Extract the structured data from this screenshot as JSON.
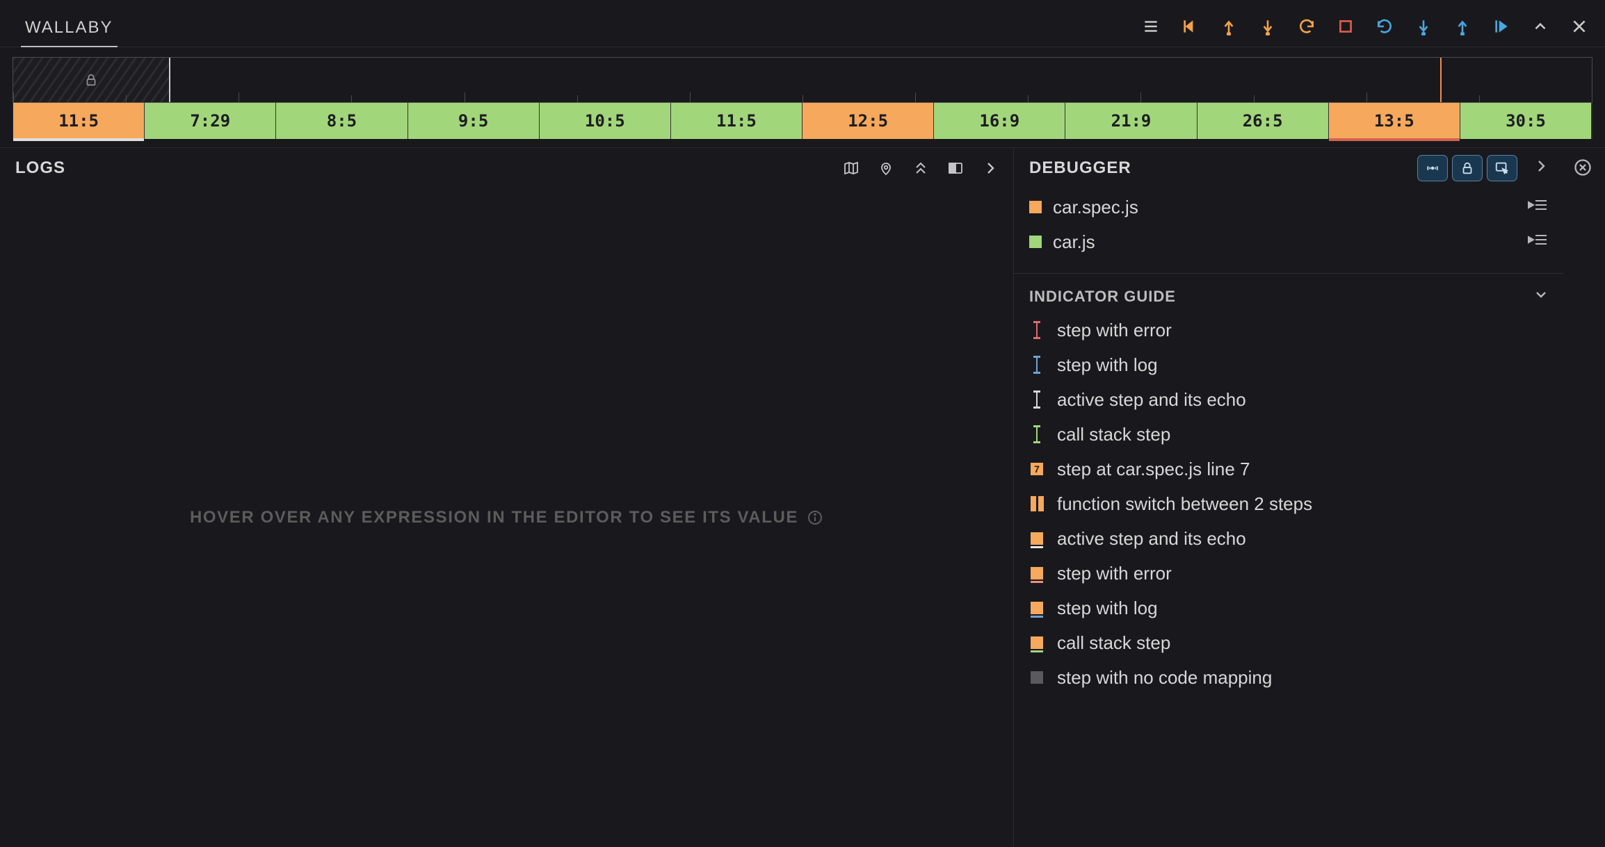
{
  "header": {
    "tab": "WALLABY"
  },
  "toolbar": {
    "buttons": [
      "menu-icon",
      "step-back-into-icon",
      "step-out-back-icon",
      "step-into-back-icon",
      "undo-icon",
      "stop-icon",
      "redo-icon",
      "step-into-icon",
      "step-out-icon",
      "play-icon",
      "collapse-icon",
      "close-icon"
    ]
  },
  "ruler": {
    "locked": true,
    "marker_pos_fraction": 0.904
  },
  "steps": [
    {
      "label": "11:5",
      "color": "orange",
      "underline": "white"
    },
    {
      "label": "7:29",
      "color": "green"
    },
    {
      "label": "8:5",
      "color": "green"
    },
    {
      "label": "9:5",
      "color": "green"
    },
    {
      "label": "10:5",
      "color": "green"
    },
    {
      "label": "11:5",
      "color": "green"
    },
    {
      "label": "12:5",
      "color": "orange"
    },
    {
      "label": "16:9",
      "color": "green"
    },
    {
      "label": "21:9",
      "color": "green"
    },
    {
      "label": "26:5",
      "color": "green"
    },
    {
      "label": "13:5",
      "color": "orange",
      "underline": "red"
    },
    {
      "label": "30:5",
      "color": "green"
    }
  ],
  "logs": {
    "title": "LOGS",
    "icons": [
      "map-icon",
      "pin-icon",
      "collapse-all-icon",
      "split-icon",
      "chevron-right-icon"
    ],
    "hint": "HOVER OVER ANY EXPRESSION IN THE EDITOR TO SEE ITS VALUE"
  },
  "debugger": {
    "title": "DEBUGGER",
    "pills": [
      "broadcast-icon",
      "lock-icon",
      "pick-element-icon"
    ],
    "chevron": "chevron-right-icon",
    "close": "close-circle-icon",
    "files": [
      {
        "name": "car.spec.js",
        "color": "orange"
      },
      {
        "name": "car.js",
        "color": "green"
      }
    ],
    "guide_title": "INDICATOR GUIDE",
    "guide": [
      {
        "icon": "ibeam",
        "color": "#e06b6b",
        "label": "step with error"
      },
      {
        "icon": "ibeam",
        "color": "#6fa3d6",
        "label": "step with log"
      },
      {
        "icon": "ibeam",
        "color": "#d6d6d6",
        "label": "active step and its echo"
      },
      {
        "icon": "ibeam",
        "color": "#a2d67a",
        "label": "call stack step"
      },
      {
        "icon": "num-square",
        "num": "7",
        "label": "step at car.spec.js line 7"
      },
      {
        "icon": "twin-bar",
        "label": "function switch between 2 steps"
      },
      {
        "icon": "square-ul",
        "ul": "#e6e6e6",
        "label": "active step and its echo"
      },
      {
        "icon": "square-ul",
        "ul": "#ec8d7e",
        "label": "step with error"
      },
      {
        "icon": "square-ul",
        "ul": "#6fa3d6",
        "label": "step with log"
      },
      {
        "icon": "square-ul",
        "ul": "#a2d67a",
        "label": "call stack step"
      },
      {
        "icon": "grey-square",
        "label": "step with no code mapping"
      }
    ]
  }
}
